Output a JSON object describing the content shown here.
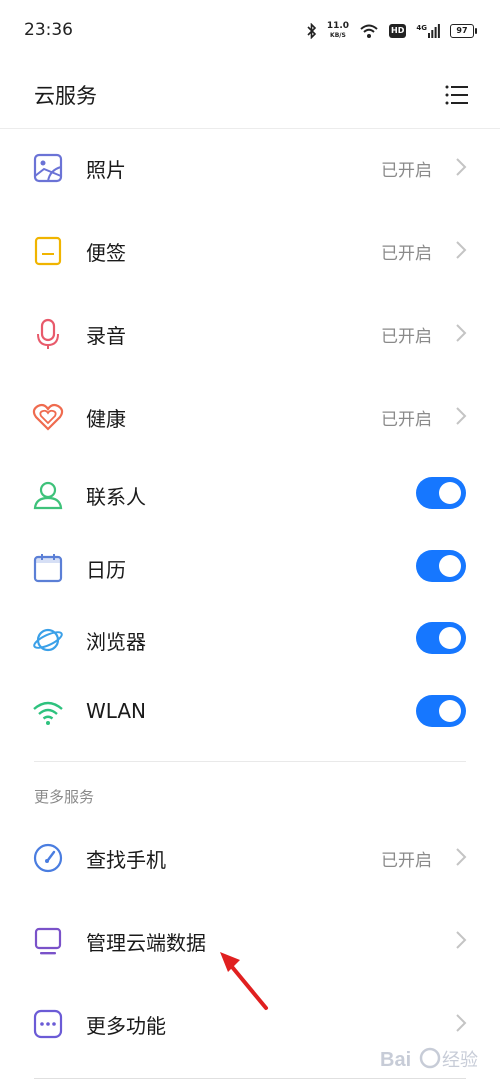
{
  "status_bar": {
    "time": "23:36",
    "speed_value": "11.0",
    "speed_unit": "KB/S",
    "hd": "HD",
    "signal": "4G",
    "battery": "97"
  },
  "header": {
    "title": "云服务"
  },
  "services": [
    {
      "label": "照片",
      "status": "已开启",
      "icon": "photo-icon",
      "color": "#6b73d6"
    },
    {
      "label": "便签",
      "status": "已开启",
      "icon": "notes-icon",
      "color": "#f0b400"
    },
    {
      "label": "录音",
      "status": "已开启",
      "icon": "microphone-icon",
      "color": "#e85a6b"
    },
    {
      "label": "健康",
      "status": "已开启",
      "icon": "health-heart-icon",
      "color": "#ef6b4f"
    },
    {
      "label": "联系人",
      "enabled": true,
      "icon": "contact-icon",
      "color": "#3ec27a"
    },
    {
      "label": "日历",
      "enabled": true,
      "icon": "calendar-icon",
      "color": "#5b7fd6"
    },
    {
      "label": "浏览器",
      "enabled": true,
      "icon": "browser-planet-icon",
      "color": "#3aa0e8"
    },
    {
      "label": "WLAN",
      "enabled": true,
      "icon": "wifi-icon",
      "color": "#2ec27e"
    }
  ],
  "more_section": {
    "title": "更多服务",
    "items": [
      {
        "label": "查找手机",
        "status": "已开启",
        "icon": "find-phone-gauge-icon",
        "color": "#4a7de0"
      },
      {
        "label": "管理云端数据",
        "icon": "cloud-data-monitor-icon",
        "color": "#7a52c9"
      },
      {
        "label": "更多功能",
        "icon": "more-functions-icon",
        "color": "#6b5bd6"
      }
    ]
  },
  "toggle_color": "#1677ff",
  "annotation_color": "#e02020",
  "watermark": "Bai经验"
}
